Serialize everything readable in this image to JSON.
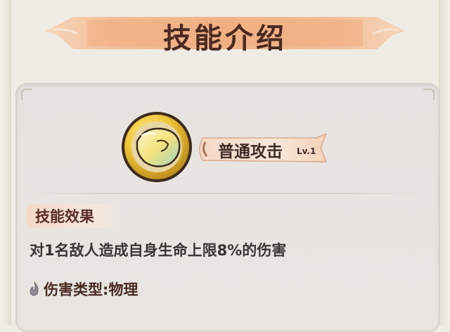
{
  "header": {
    "title": "技能介绍"
  },
  "skill": {
    "name": "普通攻击",
    "level": "Lv.1",
    "icon": "fist-icon"
  },
  "effect": {
    "label": "技能效果",
    "description": "对1名敌人造成自身生命上限8%的伤害"
  },
  "damage": {
    "icon": "flame-icon",
    "type_text": "伤害类型:物理"
  },
  "colors": {
    "banner": "#f2b48a",
    "title_text": "#4a2a22",
    "panel": "#e7e3e0",
    "icon_gold": "#e8b927",
    "effect_label_bg": "#f3d8c8"
  }
}
